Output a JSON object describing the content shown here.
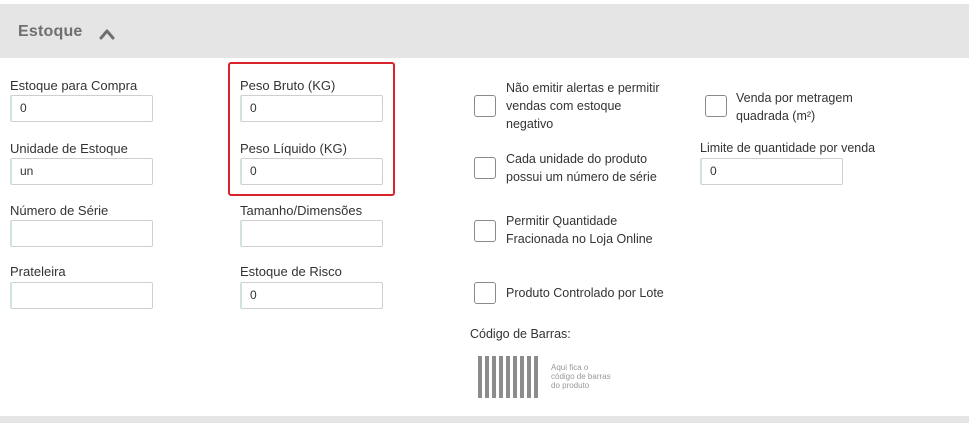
{
  "section": {
    "title": "Estoque"
  },
  "col1": {
    "estoque_compra_label": "Estoque para Compra",
    "estoque_compra_value": "0",
    "unidade_label": "Unidade de Estoque",
    "unidade_value": "un",
    "numero_serie_label": "Número de Série",
    "numero_serie_value": "",
    "prateleira_label": "Prateleira",
    "prateleira_value": ""
  },
  "col2": {
    "peso_bruto_label": "Peso Bruto (KG)",
    "peso_bruto_value": "0",
    "peso_liquido_label": "Peso Líquido (KG)",
    "peso_liquido_value": "0",
    "tamanho_label": "Tamanho/Dimensões",
    "tamanho_value": "",
    "estoque_risco_label": "Estoque de Risco",
    "estoque_risco_value": "0"
  },
  "checks": {
    "nao_emitir_l1": "Não emitir alertas e permitir",
    "nao_emitir_l2": "vendas com estoque",
    "nao_emitir_l3": "negativo",
    "serie_l1": "Cada unidade do produto",
    "serie_l2": "possui um número de série",
    "fracionada_l1": "Permitir Quantidade",
    "fracionada_l2": "Fracionada no Loja Online",
    "lote": "Produto Controlado por Lote",
    "metragem_l1": "Venda por metragem",
    "metragem_l2": "quadrada (m²)"
  },
  "limite": {
    "label": "Limite de quantidade por venda",
    "value": "0"
  },
  "barcode": {
    "label": "Código de Barras:",
    "hint_l1": "Aqui fica o",
    "hint_l2": "código de barras",
    "hint_l3": "do produto"
  },
  "colors": {
    "highlight": "#d9232d",
    "header_bg": "#e5e5e5"
  },
  "icons": {
    "collapse": "chevron-up-icon"
  }
}
